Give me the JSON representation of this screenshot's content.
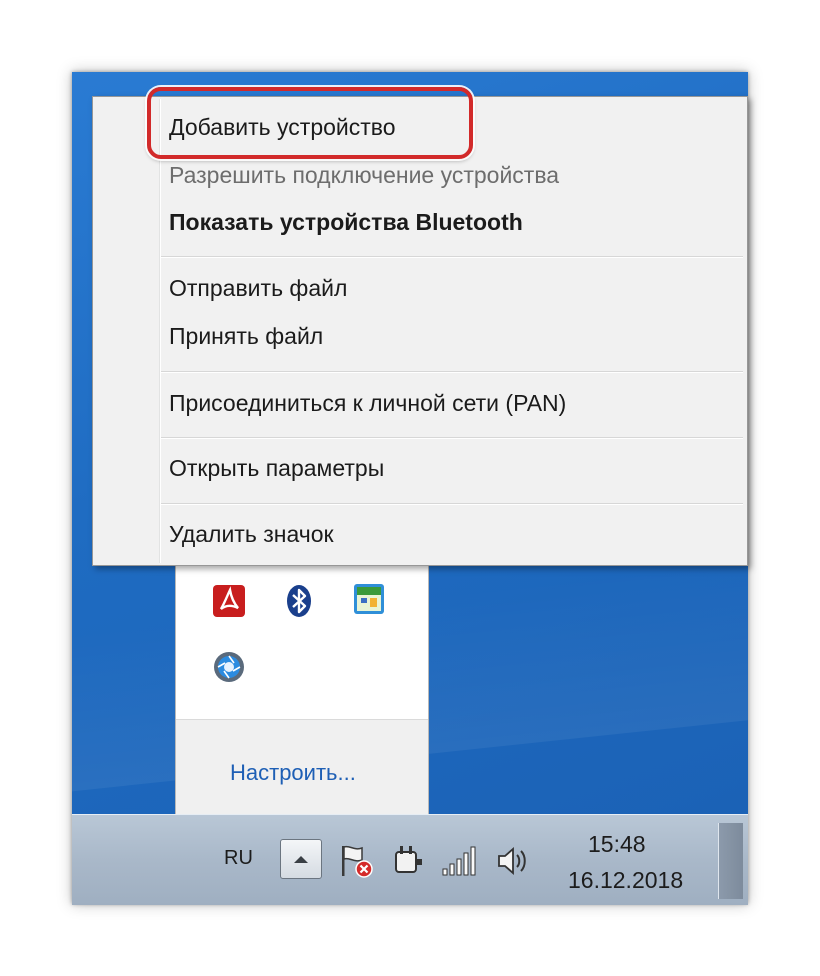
{
  "context_menu": {
    "items": [
      {
        "label": "Добавить устройство",
        "state": "highlighted"
      },
      {
        "label": "Разрешить подключение устройства",
        "state": "disabled"
      },
      {
        "label": "Показать устройства Bluetooth",
        "state": "default-bold"
      },
      {
        "label": "Отправить файл",
        "state": "normal"
      },
      {
        "label": "Принять файл",
        "state": "normal"
      },
      {
        "label": "Присоединиться к личной сети (PAN)",
        "state": "normal"
      },
      {
        "label": "Открыть параметры",
        "state": "normal"
      },
      {
        "label": "Удалить значок",
        "state": "normal"
      }
    ],
    "highlight_color": "#d22a2a"
  },
  "tray_overflow": {
    "icons": [
      "adobe-acrobat-icon",
      "bluetooth-icon",
      "calendar-icon",
      "camera-aperture-icon"
    ],
    "customize_link": "Настроить..."
  },
  "taskbar": {
    "language": "RU",
    "time": "15:48",
    "date": "16.12.2018",
    "system_icons": [
      "action-center-flag-icon",
      "power-plug-icon",
      "network-signal-icon",
      "speaker-icon"
    ]
  },
  "colors": {
    "desktop": "#1f6cc2",
    "menu_background": "#f1f1f1",
    "link": "#1e5fb5"
  }
}
